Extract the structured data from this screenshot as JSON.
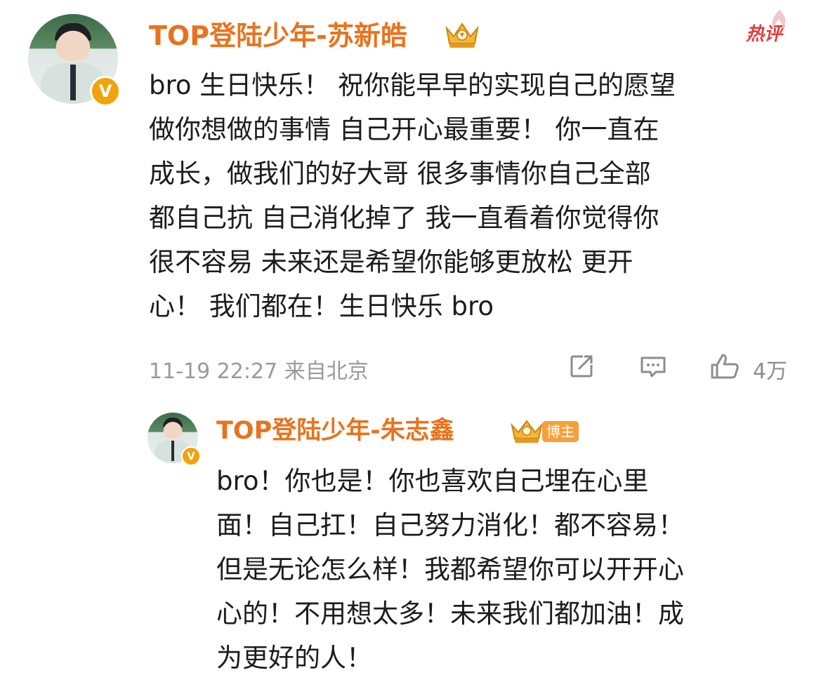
{
  "comment": {
    "username": "TOP登陆少年-苏新皓",
    "hot_label": "热评",
    "text_lines": [
      "bro 生日快乐！ 祝你能早早的实现自己的愿望",
      "做你想做的事情 自己开心最重要！ 你一直在",
      "成长，做我们的好大哥 很多事情你自己全部",
      "都自己抗 自己消化掉了 我一直看着你觉得你",
      "很不容易 未来还是希望你能够更放松 更开",
      "心！ 我们都在！生日快乐 bro"
    ],
    "time_location": "11-19 22:27 来自北京",
    "likes": "4万",
    "icons": [
      "verified-v-icon",
      "crown-badge-icon",
      "share-icon",
      "reply-icon",
      "like-icon"
    ]
  },
  "reply": {
    "username": "TOP登陆少年-朱志鑫",
    "blogger_tag": "博主",
    "text_lines": [
      "bro！你也是！你也喜欢自己埋在心里",
      "面！自己扛！自己努力消化！都不容易！",
      "但是无论怎么样！我都希望你可以开开心",
      "心的！不用想太多！未来我们都加油！成",
      "为更好的人！"
    ],
    "icons": [
      "verified-v-icon",
      "crown-badge-icon"
    ]
  },
  "colors": {
    "username": "#e8731d",
    "hot": "#e23d3d",
    "meta": "#9a9a9a",
    "verified": "#f2a20c"
  }
}
